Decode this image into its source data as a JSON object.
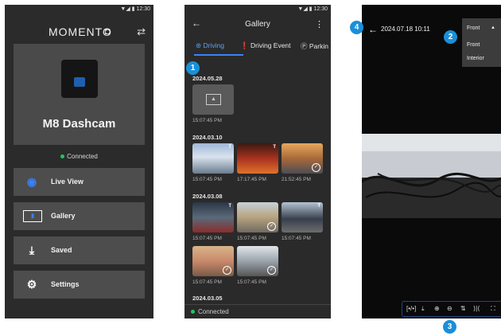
{
  "status_time": "12:30",
  "home": {
    "brand": "MOMENTO",
    "device_name": "M8 Dashcam",
    "connection": "Connected",
    "menu": [
      {
        "label": "Live View",
        "icon": "eye-icon"
      },
      {
        "label": "Gallery",
        "icon": "gallery-icon"
      },
      {
        "label": "Saved",
        "icon": "download-icon"
      },
      {
        "label": "Settings",
        "icon": "gears-icon"
      }
    ]
  },
  "gallery": {
    "title": "Gallery",
    "tabs": [
      {
        "label": "Driving",
        "icon": "steering-icon"
      },
      {
        "label": "Driving Event",
        "icon": "alert-icon"
      },
      {
        "label": "Parkin",
        "icon": "parking-icon"
      }
    ],
    "dates": [
      "2024.05.28",
      "2024.03.10",
      "2024.03.08",
      "2024.03.05"
    ],
    "times": {
      "d1": [
        "15:07:45 PM"
      ],
      "d2": [
        "15:07:45 PM",
        "17:17:45 PM",
        "21:52:45 PM"
      ],
      "d3": [
        "15:07:45 PM",
        "15:07:45 PM",
        "15:07:45 PM"
      ],
      "d4": [
        "15:07:45 PM",
        "15:07:45 PM"
      ]
    },
    "badge": "T",
    "footer_status": "Connected"
  },
  "viewer": {
    "timestamp": "2024.07.18 10:11",
    "camera_select": {
      "selected": "Front",
      "options": [
        "Front",
        "Interior"
      ]
    },
    "controls": [
      "[•/•]",
      "⤓",
      "⊕",
      "⊖",
      "⇅",
      "⟩|⟨",
      "⛶"
    ]
  },
  "callouts": [
    "1",
    "2",
    "3",
    "4"
  ],
  "colors": {
    "accent": "#1a8fd8",
    "connected": "#22c55e",
    "highlight": "#3b82f6"
  }
}
